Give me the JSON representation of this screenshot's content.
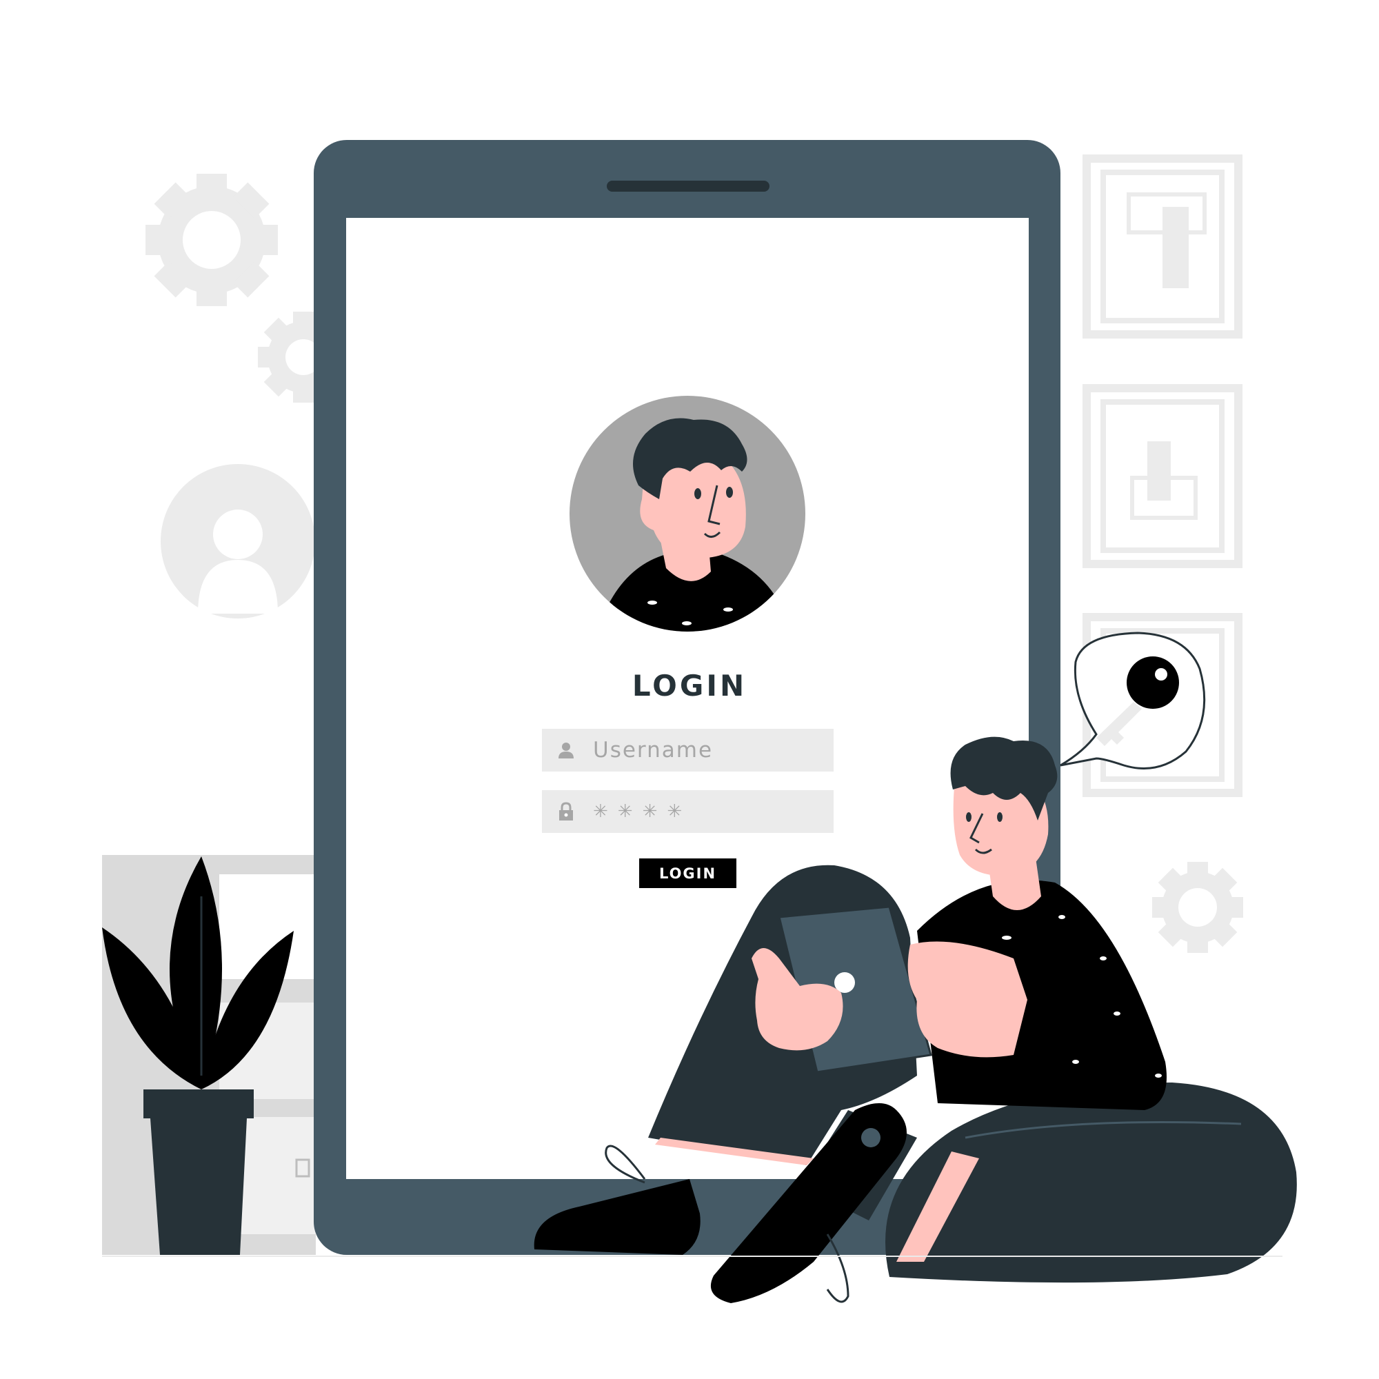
{
  "screen": {
    "title": "LOGIN",
    "username": {
      "placeholder": "Username",
      "icon": "user-icon"
    },
    "password": {
      "masked_value": "✳✳✳✳",
      "icon": "lock-icon"
    },
    "login_button_label": "LOGIN"
  },
  "speech_bubble": {
    "icon": "key-icon"
  },
  "decorations": {
    "gears": [
      "gear-icon",
      "gear-icon",
      "gear-icon"
    ],
    "profile_placeholder": "user-circle-icon",
    "window_panels": 3,
    "plant": "potted-plant"
  },
  "colors": {
    "tablet": "#455A66",
    "dark": "#263238",
    "skin": "#FFC3BD",
    "light_gray": "#EBEBEB",
    "mid_gray": "#A6A6A6",
    "button": "#000000"
  }
}
